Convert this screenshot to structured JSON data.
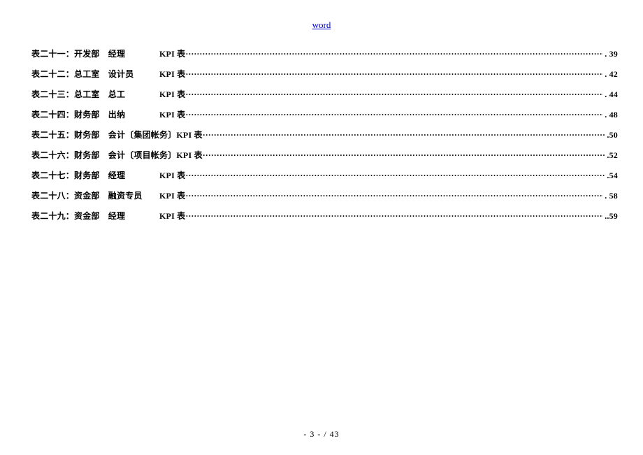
{
  "header": {
    "link_text": "word"
  },
  "toc": [
    {
      "label": "表二十一：开发部　经理　　　　KPI 表",
      "page": "39"
    },
    {
      "label": "表二十二：总工室　设计员　　　KPI 表",
      "page": "42"
    },
    {
      "label": "表二十三：总工室　总工　　　　KPI 表",
      "page": "44"
    },
    {
      "label": "表二十四：财务部　出纳　　　　KPI 表",
      "page": "48"
    },
    {
      "label": "表二十五：财务部　会计〔集团帐务〕KPI 表",
      "page": "50"
    },
    {
      "label": "表二十六：财务部　会计〔项目帐务〕KPI 表",
      "page": "52"
    },
    {
      "label": "表二十七：财务部　经理　　　　KPI 表",
      "page": "54"
    },
    {
      "label": "表二十八：资金部　融资专员　　KPI 表",
      "page": "58"
    },
    {
      "label": "表二十九：资金部　经理　　　　KPI 表",
      "page": "59"
    }
  ],
  "footer": {
    "text": "- 3 -  / 43"
  }
}
